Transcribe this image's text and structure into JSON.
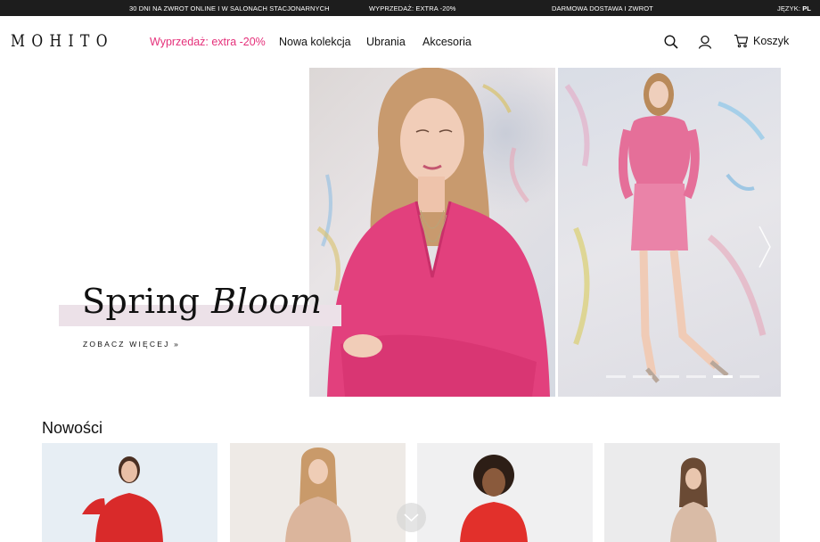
{
  "topbar": {
    "msg1": "30 DNI NA ZWROT ONLINE I W SALONACH STACJONARNYCH",
    "msg2": "WYPRZEDAŻ: EXTRA -20%",
    "msg3": "DARMOWA DOSTAWA I ZWROT",
    "lang_label": "JĘZYK:",
    "lang_value": "PL"
  },
  "header": {
    "logo": "MOHITO",
    "nav": [
      "Wyprzedaż: extra -20%",
      "Nowa kolekcja",
      "Ubrania",
      "Akcesoria"
    ],
    "cart_label": "Koszyk",
    "icons": [
      "search-icon",
      "user-icon",
      "cart-icon"
    ]
  },
  "hero": {
    "title_regular": "Spring",
    "title_italic": "Bloom",
    "cta": "ZOBACZ WIĘCEJ »",
    "slides_count": 6,
    "active_slide_index": 4
  },
  "section": {
    "title": "Nowości"
  },
  "colors": {
    "accent_pink": "#e5307a",
    "topbar_bg": "#1d1d1d",
    "headline_highlight": "#ece1e8"
  }
}
